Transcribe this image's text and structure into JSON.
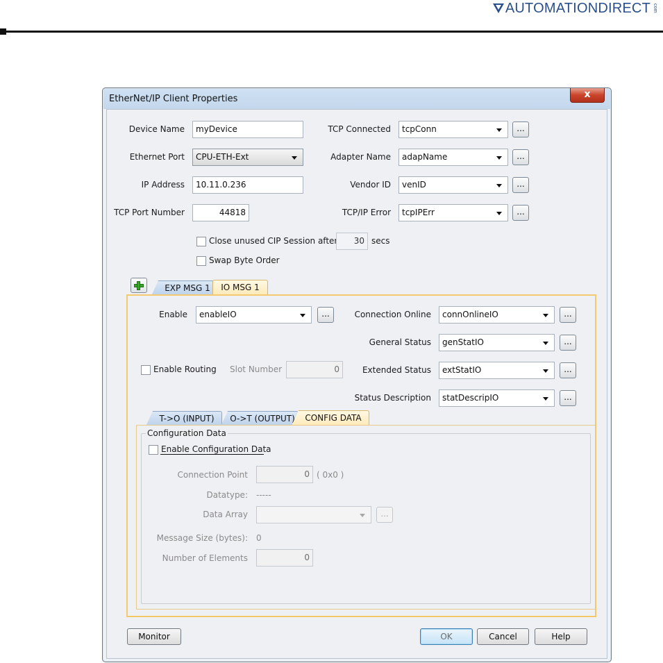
{
  "brand": {
    "text": "AUTOMATIONDIRECT",
    "mark": "com"
  },
  "dialog": {
    "title": "EtherNet/IP Client Properties",
    "close_glyph": "x"
  },
  "top": {
    "device_name": {
      "label": "Device Name",
      "value": "myDevice"
    },
    "ethernet_port": {
      "label": "Ethernet Port",
      "value": "CPU-ETH-Ext"
    },
    "ip_address": {
      "label": "IP Address",
      "value": "10.11.0.236"
    },
    "tcp_port": {
      "label": "TCP Port Number",
      "value": "44818"
    },
    "tcp_connected": {
      "label": "TCP Connected",
      "value": "tcpConn"
    },
    "adapter_name": {
      "label": "Adapter Name",
      "value": "adapName"
    },
    "vendor_id": {
      "label": "Vendor ID",
      "value": "venID"
    },
    "tcpip_error": {
      "label": "TCP/IP Error",
      "value": "tcpIPErr"
    },
    "ellipsis": "...",
    "close_session": {
      "label": "Close unused CIP Session after",
      "value": "30",
      "unit": "secs",
      "checked": false
    },
    "swap_byte": {
      "label": "Swap Byte Order",
      "checked": false
    }
  },
  "msg_tabs": [
    {
      "label": "EXP MSG 1",
      "active": false
    },
    {
      "label": "IO MSG 1",
      "active": true
    }
  ],
  "io": {
    "enable": {
      "label": "Enable",
      "value": "enableIO"
    },
    "connection_online": {
      "label": "Connection Online",
      "value": "connOnlineIO"
    },
    "general_status": {
      "label": "General Status",
      "value": "genStatIO"
    },
    "extended_status": {
      "label": "Extended Status",
      "value": "extStatIO"
    },
    "status_description": {
      "label": "Status Description",
      "value": "statDescripIO"
    },
    "enable_routing": {
      "label": "Enable Routing",
      "checked": false
    },
    "slot_number": {
      "label": "Slot Number",
      "value": "0"
    }
  },
  "sub_tabs": [
    {
      "label": "T->O (INPUT)",
      "active": false
    },
    {
      "label": "O->T (OUTPUT)",
      "active": false
    },
    {
      "label": "CONFIG DATA",
      "active": true
    }
  ],
  "config": {
    "group_title": "Configuration Data",
    "enable_config": {
      "label": "Enable Configuration Data",
      "checked": false
    },
    "connection_point": {
      "label": "Connection Point",
      "value": "0",
      "hex": "( 0x0 )"
    },
    "datatype": {
      "label": "Datatype:",
      "value": "-----"
    },
    "data_array": {
      "label": "Data Array",
      "value": ""
    },
    "message_size": {
      "label": "Message Size (bytes):",
      "value": "0"
    },
    "number_of_elements": {
      "label": "Number of Elements",
      "value": "0"
    }
  },
  "buttons": {
    "monitor": "Monitor",
    "ok": "OK",
    "cancel": "Cancel",
    "help": "Help"
  }
}
